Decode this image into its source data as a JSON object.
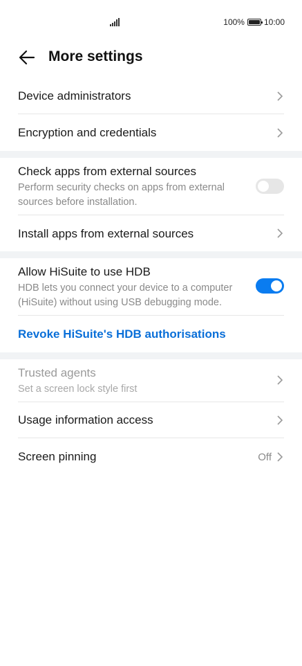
{
  "status_bar": {
    "battery": "100%",
    "time": "10:00"
  },
  "header": {
    "title": "More settings"
  },
  "sections": {
    "device_admins": {
      "label": "Device administrators"
    },
    "encryption": {
      "label": "Encryption and credentials"
    },
    "check_apps": {
      "label": "Check apps from external sources",
      "sub": "Perform security checks on apps from external sources before installation.",
      "toggle": "off"
    },
    "install_apps": {
      "label": "Install apps from external sources"
    },
    "hisuite": {
      "label": "Allow HiSuite to use HDB",
      "sub": "HDB lets you connect your device to a computer (HiSuite) without using USB debugging mode.",
      "toggle": "on"
    },
    "revoke": {
      "label": "Revoke HiSuite's HDB authorisations"
    },
    "trusted_agents": {
      "label": "Trusted agents",
      "sub": "Set a screen lock style first"
    },
    "usage_info": {
      "label": "Usage information access"
    },
    "screen_pinning": {
      "label": "Screen pinning",
      "value": "Off"
    }
  },
  "colors": {
    "accent": "#0a7cf0",
    "link": "#0a6fd8",
    "separator": "#f1f3f5"
  }
}
